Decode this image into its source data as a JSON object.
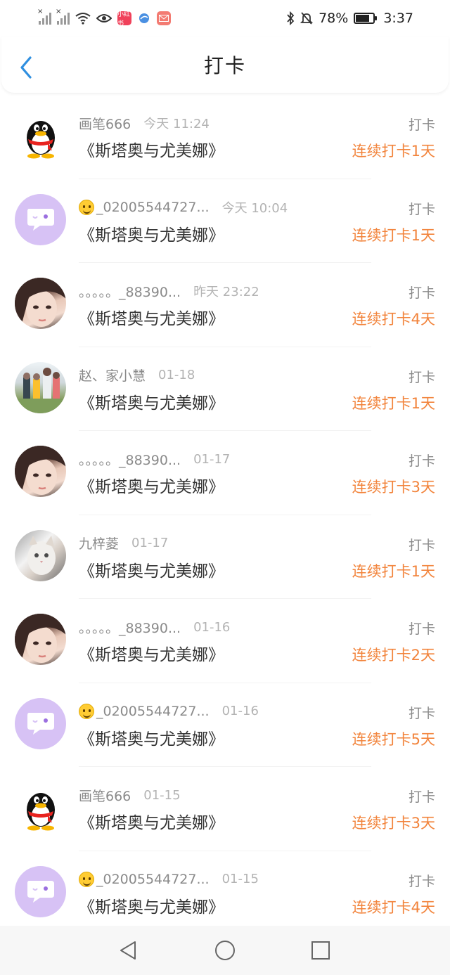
{
  "status_bar": {
    "battery": "78%",
    "time": "3:37",
    "app_badge_1": "小红书"
  },
  "header": {
    "title": "打卡"
  },
  "items": [
    {
      "user": "画笔666",
      "emoji": false,
      "time": "今天 11:24",
      "book": "《斯塔奥与尤美娜》",
      "tag": "打卡",
      "streak": "连续打卡1天",
      "avatar": "qq"
    },
    {
      "user": "_02005544727...",
      "emoji": true,
      "time": "今天 10:04",
      "book": "《斯塔奥与尤美娜》",
      "tag": "打卡",
      "streak": "连续打卡1天",
      "avatar": "chat"
    },
    {
      "user": "。。。。。_88390...",
      "emoji": false,
      "time": "昨天 23:22",
      "book": "《斯塔奥与尤美娜》",
      "tag": "打卡",
      "streak": "连续打卡4天",
      "avatar": "girl"
    },
    {
      "user": "赵、家小慧",
      "emoji": false,
      "time": "01-18",
      "book": "《斯塔奥与尤美娜》",
      "tag": "打卡",
      "streak": "连续打卡1天",
      "avatar": "group"
    },
    {
      "user": "。。。。。_88390...",
      "emoji": false,
      "time": "01-17",
      "book": "《斯塔奥与尤美娜》",
      "tag": "打卡",
      "streak": "连续打卡3天",
      "avatar": "girl"
    },
    {
      "user": "九梓菱",
      "emoji": false,
      "time": "01-17",
      "book": "《斯塔奥与尤美娜》",
      "tag": "打卡",
      "streak": "连续打卡1天",
      "avatar": "cat"
    },
    {
      "user": "。。。。。_88390...",
      "emoji": false,
      "time": "01-16",
      "book": "《斯塔奥与尤美娜》",
      "tag": "打卡",
      "streak": "连续打卡2天",
      "avatar": "girl"
    },
    {
      "user": "_02005544727...",
      "emoji": true,
      "time": "01-16",
      "book": "《斯塔奥与尤美娜》",
      "tag": "打卡",
      "streak": "连续打卡5天",
      "avatar": "chat"
    },
    {
      "user": "画笔666",
      "emoji": false,
      "time": "01-15",
      "book": "《斯塔奥与尤美娜》",
      "tag": "打卡",
      "streak": "连续打卡3天",
      "avatar": "qq"
    },
    {
      "user": "_02005544727...",
      "emoji": true,
      "time": "01-15",
      "book": "《斯塔奥与尤美娜》",
      "tag": "打卡",
      "streak": "连续打卡4天",
      "avatar": "chat"
    }
  ],
  "colors": {
    "accent": "#2f8fe0",
    "streak": "#f2843c",
    "muted": "#8a8a8a"
  },
  "icons": {
    "back": "chevron-left-icon",
    "nav_back": "triangle-back-icon",
    "nav_home": "circle-home-icon",
    "nav_recent": "square-recents-icon"
  }
}
